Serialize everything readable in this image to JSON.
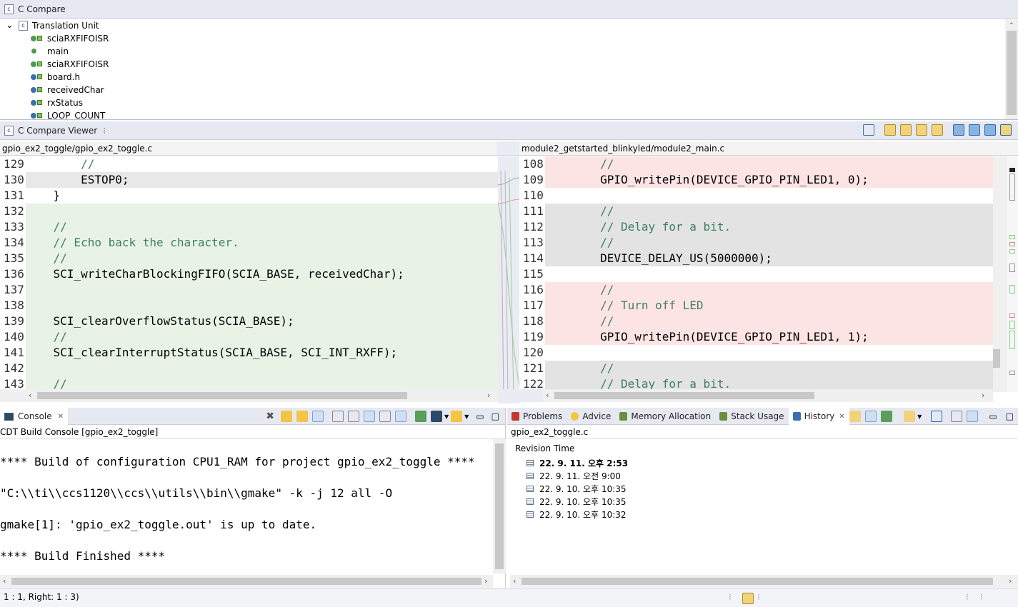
{
  "compare_panel": {
    "title": "C Compare",
    "tree": [
      {
        "label": "Translation Unit",
        "icon": "translation-unit-icon"
      },
      {
        "label": "sciaRXFIFOISR",
        "icon": "function-declaration-icon"
      },
      {
        "label": "main",
        "icon": "function-icon"
      },
      {
        "label": "sciaRXFIFOISR",
        "icon": "function-definition-icon"
      },
      {
        "label": "board.h",
        "icon": "include-icon"
      },
      {
        "label": "receivedChar",
        "icon": "variable-icon"
      },
      {
        "label": "rxStatus",
        "icon": "variable-icon"
      },
      {
        "label": "LOOP_COUNT",
        "icon": "macro-icon"
      }
    ]
  },
  "viewer": {
    "title": "C Compare Viewer",
    "left_path": "gpio_ex2_toggle/gpio_ex2_toggle.c",
    "right_path": "module2_getstarted_blinkyled/module2_main.c",
    "left_lines": [
      {
        "n": "129",
        "text": "        //",
        "cmt": true,
        "bg": "#ffffff"
      },
      {
        "n": "130",
        "text": "        ESTOP0;",
        "cmt": false,
        "bg": "#e8e8e8",
        "hl": "ESTOP0;"
      },
      {
        "n": "131",
        "text": "    }",
        "cmt": false,
        "bg": "#ffffff"
      },
      {
        "n": "132",
        "text": "",
        "cmt": false,
        "bg": "#e8f3e6"
      },
      {
        "n": "133",
        "text": "    //",
        "cmt": true,
        "bg": "#e8f3e6"
      },
      {
        "n": "134",
        "text": "    // Echo back the character.",
        "cmt": true,
        "bg": "#e8f3e6"
      },
      {
        "n": "135",
        "text": "    //",
        "cmt": true,
        "bg": "#e8f3e6"
      },
      {
        "n": "136",
        "text": "    SCI_writeCharBlockingFIFO(SCIA_BASE, receivedChar);",
        "cmt": false,
        "bg": "#e8f3e6"
      },
      {
        "n": "137",
        "text": "",
        "cmt": false,
        "bg": "#e8f3e6"
      },
      {
        "n": "138",
        "text": "",
        "cmt": false,
        "bg": "#e8f3e6"
      },
      {
        "n": "139",
        "text": "    SCI_clearOverflowStatus(SCIA_BASE);",
        "cmt": false,
        "bg": "#e8f3e6"
      },
      {
        "n": "140",
        "text": "    //",
        "cmt": true,
        "bg": "#e8f3e6"
      },
      {
        "n": "141",
        "text": "    SCI_clearInterruptStatus(SCIA_BASE, SCI_INT_RXFF);",
        "cmt": false,
        "bg": "#e8f3e6"
      },
      {
        "n": "142",
        "text": "",
        "cmt": false,
        "bg": "#e8f3e6"
      },
      {
        "n": "143",
        "text": "    //",
        "cmt": true,
        "bg": "#e8f3e6"
      }
    ],
    "right_lines": [
      {
        "n": "108",
        "text": "        //",
        "cmt": true,
        "bg": "#fde4e4"
      },
      {
        "n": "109",
        "text": "        GPIO_writePin(DEVICE_GPIO_PIN_LED1, 0);",
        "cmt": false,
        "bg": "#fde4e4"
      },
      {
        "n": "110",
        "text": "",
        "cmt": false,
        "bg": "#ffffff"
      },
      {
        "n": "111",
        "text": "        //",
        "cmt": true,
        "bg": "#e3e3e3"
      },
      {
        "n": "112",
        "text": "        // Delay for a bit.",
        "cmt": true,
        "bg": "#e3e3e3"
      },
      {
        "n": "113",
        "text": "        //",
        "cmt": true,
        "bg": "#e3e3e3"
      },
      {
        "n": "114",
        "text": "        DEVICE_DELAY_US(5000000);",
        "cmt": false,
        "bg": "#e3e3e3"
      },
      {
        "n": "115",
        "text": "",
        "cmt": false,
        "bg": "#ffffff"
      },
      {
        "n": "116",
        "text": "        //",
        "cmt": true,
        "bg": "#fde4e4"
      },
      {
        "n": "117",
        "text": "        // Turn off LED",
        "cmt": true,
        "bg": "#fde4e4"
      },
      {
        "n": "118",
        "text": "        //",
        "cmt": true,
        "bg": "#fde4e4"
      },
      {
        "n": "119",
        "text": "        GPIO_writePin(DEVICE_GPIO_PIN_LED1, 1);",
        "cmt": false,
        "bg": "#fde4e4"
      },
      {
        "n": "120",
        "text": "",
        "cmt": false,
        "bg": "#ffffff"
      },
      {
        "n": "121",
        "text": "        //",
        "cmt": true,
        "bg": "#e3e3e3"
      },
      {
        "n": "122",
        "text": "        // Delay for a bit.",
        "cmt": true,
        "bg": "#e3e3e3"
      }
    ]
  },
  "console": {
    "tab_label": "Console",
    "subtitle": "CDT Build Console [gpio_ex2_toggle]",
    "lines": [
      "**** Build of configuration CPU1_RAM for project gpio_ex2_toggle ****",
      "\"C:\\\\ti\\\\ccs1120\\\\ccs\\\\utils\\\\bin\\\\gmake\" -k -j 12 all -O",
      "gmake[1]: 'gpio_ex2_toggle.out' is up to date.",
      "**** Build Finished ****"
    ]
  },
  "right_tabs": {
    "tabs": [
      {
        "label": "Problems",
        "icon": "problems-icon"
      },
      {
        "label": "Advice",
        "icon": "lightbulb-icon"
      },
      {
        "label": "Memory Allocation",
        "icon": "memory-icon"
      },
      {
        "label": "Stack Usage",
        "icon": "stack-icon"
      },
      {
        "label": "History",
        "icon": "history-icon"
      }
    ],
    "file": "gpio_ex2_toggle.c",
    "column_header": "Revision Time",
    "revisions": [
      {
        "time": "22. 9. 11. 오후 2:53",
        "bold": true
      },
      {
        "time": "22. 9. 11. 오전 9:00",
        "bold": false
      },
      {
        "time": "22. 9. 10. 오후 10:35",
        "bold": false
      },
      {
        "time": "22. 9. 10. 오후 10:35",
        "bold": false
      },
      {
        "time": "22. 9. 10. 오후 10:32",
        "bold": false
      }
    ]
  },
  "status_bar": {
    "text": "1 : 1, Right: 1 : 3)"
  }
}
